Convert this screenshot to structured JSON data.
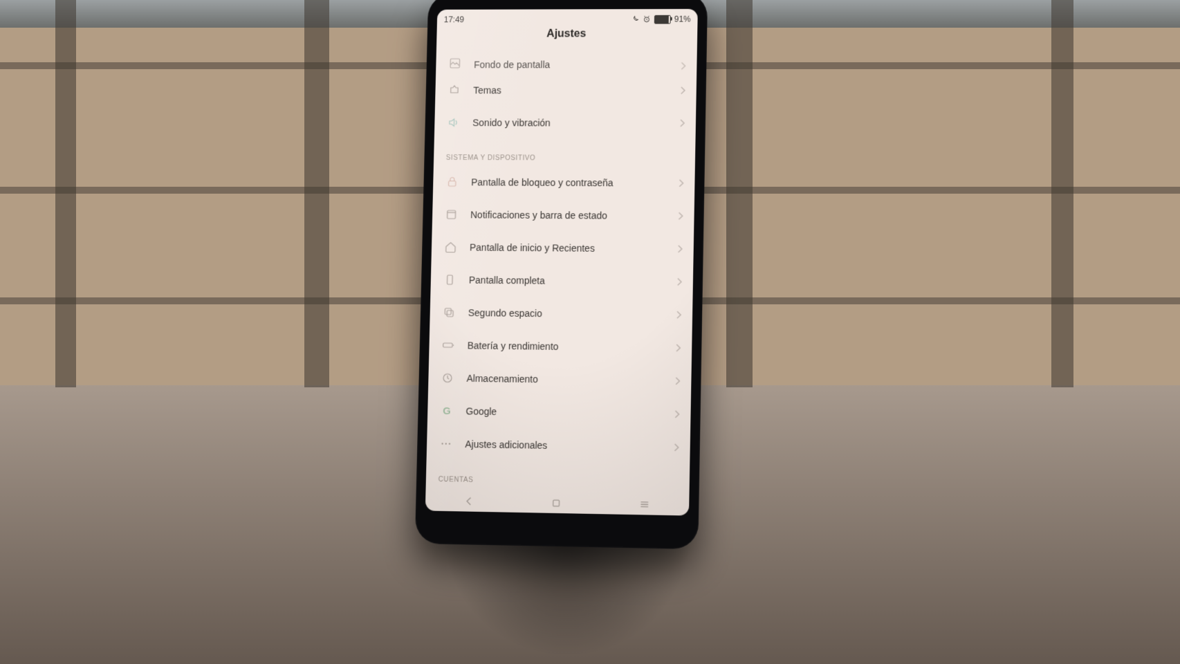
{
  "statusbar": {
    "time": "17:49",
    "battery_pct": "91%"
  },
  "title": "Ajustes",
  "partial_top_row": {
    "label": "Fondo de pantalla"
  },
  "group1": [
    {
      "icon": "themes-icon",
      "label": "Temas"
    },
    {
      "icon": "sound-icon",
      "label": "Sonido y vibración"
    }
  ],
  "section_system_header": "SISTEMA Y DISPOSITIVO",
  "group2": [
    {
      "icon": "lock-icon",
      "label": "Pantalla de bloqueo y contraseña"
    },
    {
      "icon": "notification-icon",
      "label": "Notificaciones y barra de estado"
    },
    {
      "icon": "home-icon",
      "label": "Pantalla de inicio y Recientes"
    },
    {
      "icon": "fullscreen-icon",
      "label": "Pantalla completa"
    },
    {
      "icon": "dual-apps-icon",
      "label": "Segundo espacio"
    },
    {
      "icon": "battery-icon",
      "label": "Batería y rendimiento"
    },
    {
      "icon": "storage-icon",
      "label": "Almacenamiento"
    },
    {
      "icon": "google-icon",
      "label": "Google"
    },
    {
      "icon": "more-icon",
      "label": "Ajustes adicionales"
    }
  ],
  "section_accounts_header": "CUENTAS"
}
